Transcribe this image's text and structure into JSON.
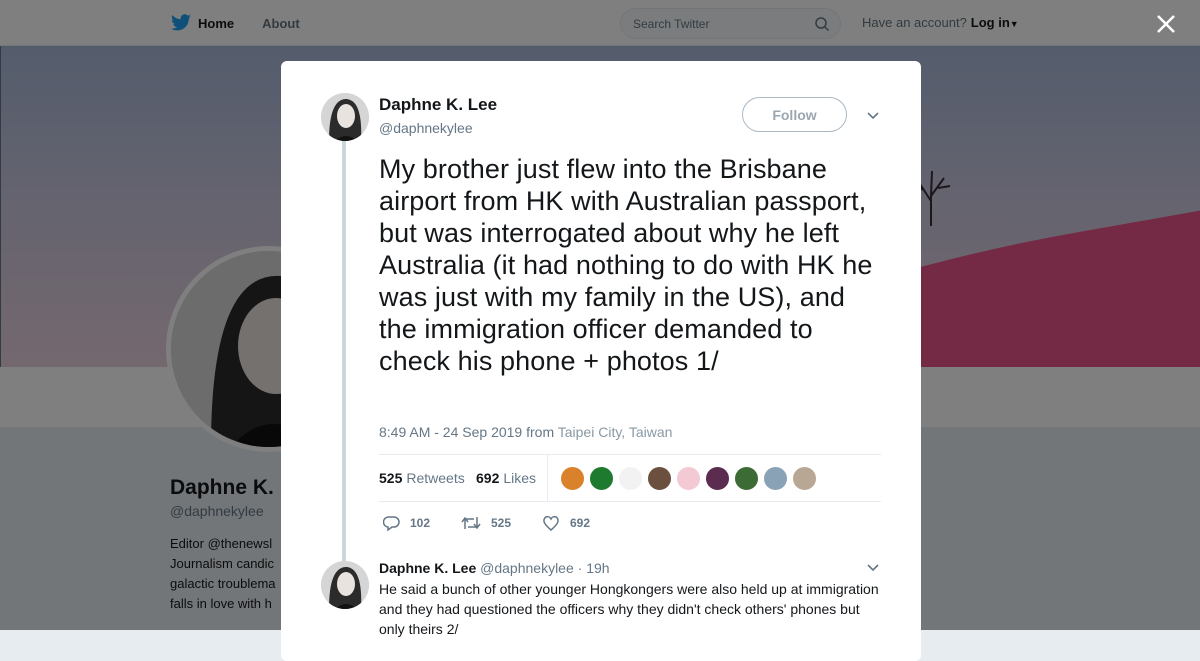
{
  "nav": {
    "home": "Home",
    "about": "About",
    "search_placeholder": "Search Twitter",
    "account_prompt": "Have an account?",
    "login": "Log in"
  },
  "background_profile": {
    "name": "Daphne K.",
    "handle": "@daphnekylee",
    "bio_lines": [
      "Editor @thenewsl",
      "Journalism candic",
      "galactic troublema",
      "falls in love with h"
    ]
  },
  "tweet": {
    "author": "Daphne K. Lee",
    "handle": "@daphnekylee",
    "follow": "Follow",
    "text": "My brother just flew into the Brisbane airport from HK with Australian passport, but was interrogated about why he left Australia (it had nothing to do with HK he was just with my family in the US), and the immigration officer demanded to check his phone + photos 1/",
    "timestamp": "8:49 AM - 24 Sep 2019 from",
    "location": "Taipei City, Taiwan",
    "retweets_count": "525",
    "retweets_label": "Retweets",
    "likes_count": "692",
    "likes_label": "Likes",
    "replies": "102",
    "retweets": "525",
    "likes": "692"
  },
  "reply": {
    "author": "Daphne K. Lee",
    "handle": "@daphnekylee",
    "time": "· 19h",
    "text": "He said a bunch of other younger Hongkongers were also held up at immigration and they had questioned the officers why they didn't check others' phones but only theirs 2/"
  },
  "liker_colors": [
    "#d9822b",
    "#1e7a2e",
    "#f2f2f2",
    "#6b5040",
    "#f3c9d3",
    "#5b2c4f",
    "#3d6b35",
    "#8aa2b5",
    "#b9a795"
  ],
  "colors": {
    "accent": "#1da1f2",
    "hill": "#e95488"
  }
}
